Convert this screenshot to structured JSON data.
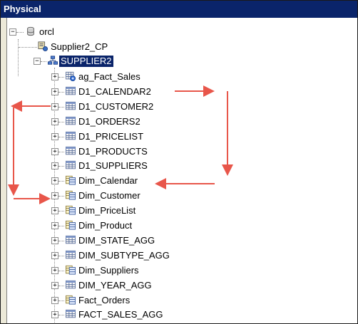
{
  "title": "Physical",
  "tree": {
    "database": "orcl",
    "connection_pool": "Supplier2_CP",
    "schema": "SUPPLIER2",
    "tables": [
      {
        "label": "ag_Fact_Sales",
        "icon": "aggregate-table-icon"
      },
      {
        "label": "D1_CALENDAR2",
        "icon": "physical-table-icon"
      },
      {
        "label": "D1_CUSTOMER2",
        "icon": "physical-table-icon"
      },
      {
        "label": "D1_ORDERS2",
        "icon": "physical-table-icon"
      },
      {
        "label": "D1_PRICELIST",
        "icon": "physical-table-icon"
      },
      {
        "label": "D1_PRODUCTS",
        "icon": "physical-table-icon"
      },
      {
        "label": "D1_SUPPLIERS",
        "icon": "physical-table-icon"
      },
      {
        "label": "Dim_Calendar",
        "icon": "alias-table-icon"
      },
      {
        "label": "Dim_Customer",
        "icon": "alias-table-icon"
      },
      {
        "label": "Dim_PriceList",
        "icon": "alias-table-icon"
      },
      {
        "label": "Dim_Product",
        "icon": "alias-table-icon"
      },
      {
        "label": "DIM_STATE_AGG",
        "icon": "physical-table-icon"
      },
      {
        "label": "DIM_SUBTYPE_AGG",
        "icon": "physical-table-icon"
      },
      {
        "label": "Dim_Suppliers",
        "icon": "alias-table-icon"
      },
      {
        "label": "DIM_YEAR_AGG",
        "icon": "physical-table-icon"
      },
      {
        "label": "Fact_Orders",
        "icon": "alias-table-icon"
      },
      {
        "label": "FACT_SALES_AGG",
        "icon": "physical-table-icon"
      }
    ]
  },
  "colors": {
    "title_bg": "#0a246a",
    "selection_bg": "#0a246a",
    "arrow": "#e8564a"
  }
}
